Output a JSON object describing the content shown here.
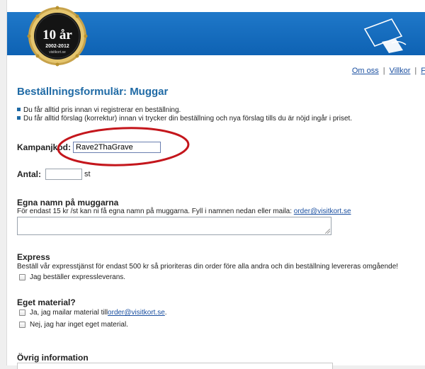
{
  "badge": {
    "big": "10 år",
    "years": "2002-2012",
    "site": "visitkort.se"
  },
  "toplinks": [
    {
      "label": "Om oss"
    },
    {
      "label": "Villkor"
    },
    {
      "label": "F"
    }
  ],
  "form": {
    "title": "Beställningsformulär: Muggar",
    "bullets": [
      "Du får alltid pris innan vi registrerar en beställning.",
      "Du får alltid förslag (korrektur) innan vi trycker din beställning och nya förslag tills du är nöjd ingår i priset."
    ],
    "kampanjkod": {
      "label": "Kampanjkod:",
      "value": "Rave2ThaGrave"
    },
    "antal": {
      "label": "Antal:",
      "value": "",
      "unit": "st"
    },
    "names": {
      "heading": "Egna namn på muggarna",
      "text": "För endast 15 kr /st kan ni få egna namn på muggarna. Fyll i namnen nedan eller maila: ",
      "email": "order@visitkort.se",
      "textarea_value": ""
    },
    "express": {
      "heading": "Express",
      "text": "Beställ vår expresstjänst för endast 500 kr så prioriteras din order före alla andra och din beställning levereras omgående!",
      "checkbox_label": "Jag beställer expressleverans."
    },
    "material": {
      "heading": "Eget material?",
      "option_yes_prefix": "Ja, jag mailar material till ",
      "option_yes_email": "order@visitkort.se",
      "option_yes_suffix": ".",
      "option_no": "Nej, jag har inget eget material."
    },
    "other": {
      "heading": "Övrig information"
    }
  },
  "colors": {
    "banner": "#1069ba",
    "title": "#1f6aa5",
    "link": "#1a4fa0",
    "highlight": "#c4161c"
  }
}
